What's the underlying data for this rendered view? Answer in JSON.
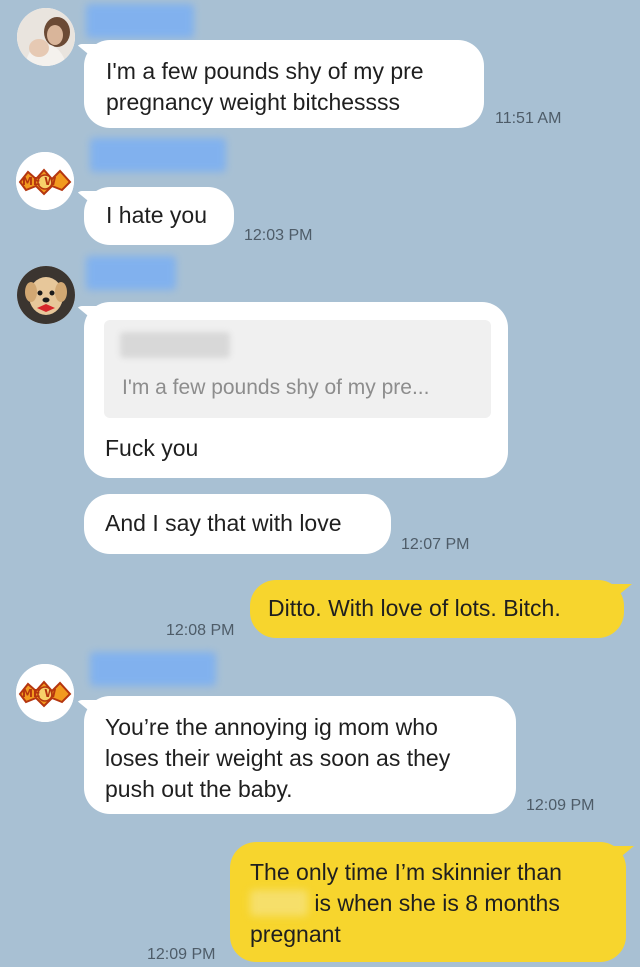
{
  "conversation": {
    "messages": [
      {
        "direction": "received",
        "sender_avatar": "photo-person-avatar",
        "text": "I'm a few pounds shy of my pre\npregnancy weight bitchessss",
        "time": "11:51 AM"
      },
      {
        "direction": "received",
        "sender_avatar": "meow-sticker-avatar",
        "text": "I hate you",
        "time": "12:03 PM"
      },
      {
        "direction": "received",
        "sender_avatar": "dog-avatar",
        "reply_to": "I'm a few pounds shy of my pre...",
        "text": "Fuck you",
        "time": ""
      },
      {
        "direction": "received",
        "sender_avatar": "dog-avatar",
        "text": "And I say that with love",
        "time": "12:07 PM"
      },
      {
        "direction": "sent",
        "text": "Ditto. With love of lots. Bitch.",
        "time": "12:08 PM"
      },
      {
        "direction": "received",
        "sender_avatar": "meow-sticker-avatar",
        "text": "You’re the annoying ig mom who\nloses their weight as soon as they\npush out the baby.",
        "time": "12:09 PM"
      },
      {
        "direction": "sent",
        "text_line1": "The only time I’m skinnier than",
        "text_line2_after_redaction": " is when she is 8 months",
        "text_line3": "pregnant",
        "time": "12:09 PM"
      }
    ]
  },
  "colors": {
    "background": "#a8c0d3",
    "received_bubble": "#ffffff",
    "sent_bubble": "#f7d52d",
    "timestamp": "#4e5c68",
    "name_redaction": "#7fb1f0"
  }
}
